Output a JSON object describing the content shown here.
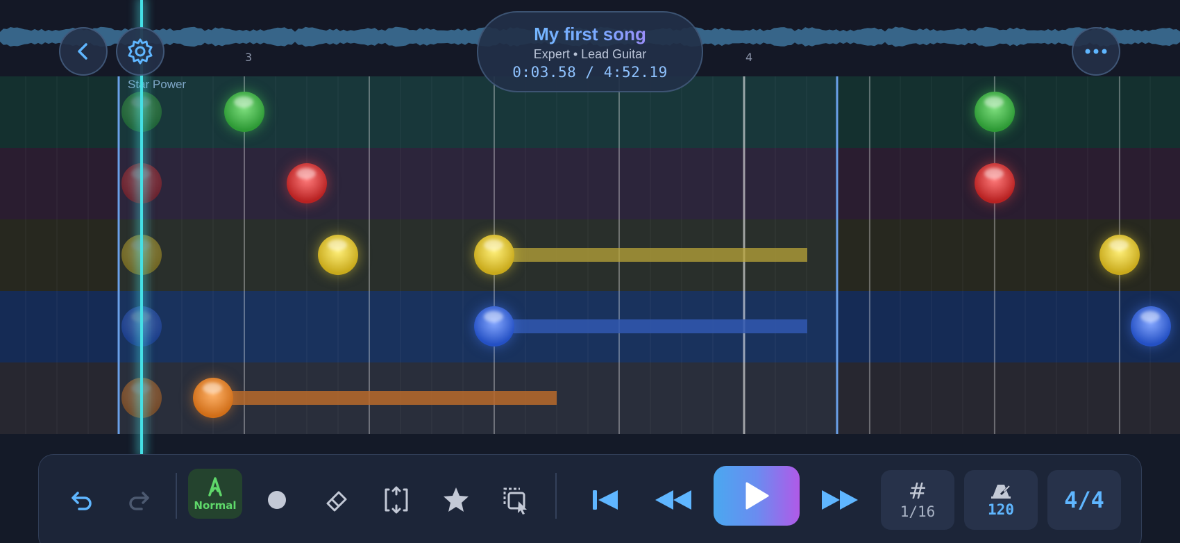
{
  "header": {
    "song_title": "My first song",
    "subtitle": "Expert • Lead Guitar",
    "time": "0:03.58 / 4:52.19"
  },
  "ruler": {
    "measures": [
      "3",
      "4"
    ]
  },
  "highway": {
    "section_label": "Star Power",
    "lanes": [
      {
        "name": "green",
        "color": "#3fb84a"
      },
      {
        "name": "red",
        "color": "#e03a3a"
      },
      {
        "name": "yellow",
        "color": "#e9cf2e"
      },
      {
        "name": "blue",
        "color": "#3d6fe0"
      },
      {
        "name": "orange",
        "color": "#ee8a2a"
      }
    ]
  },
  "buttons": {
    "back": "back-icon",
    "settings": "gear-icon",
    "more": "more-icon"
  },
  "toolbar": {
    "undo": "undo-icon",
    "redo": "redo-icon",
    "strum_mode_label": "Normal",
    "note_tool": "dot-icon",
    "eraser_tool": "eraser-icon",
    "select_tool": "select-icon",
    "star_power_tool": "star-icon",
    "copy_tool": "copy-select-icon",
    "skip_start": "skip-start-icon",
    "rewind": "rewind-icon",
    "play": "play-icon",
    "fast_forward": "fast-forward-icon",
    "grid_value": "1/16",
    "tempo_value": "120",
    "time_signature": "4/4"
  },
  "colors": {
    "accent": "#5fb6ff",
    "playhead": "#45e0e6",
    "play_gradient_start": "#4aa8f0",
    "play_gradient_end": "#b05ae8",
    "normal_mode": "#5fd86a"
  }
}
